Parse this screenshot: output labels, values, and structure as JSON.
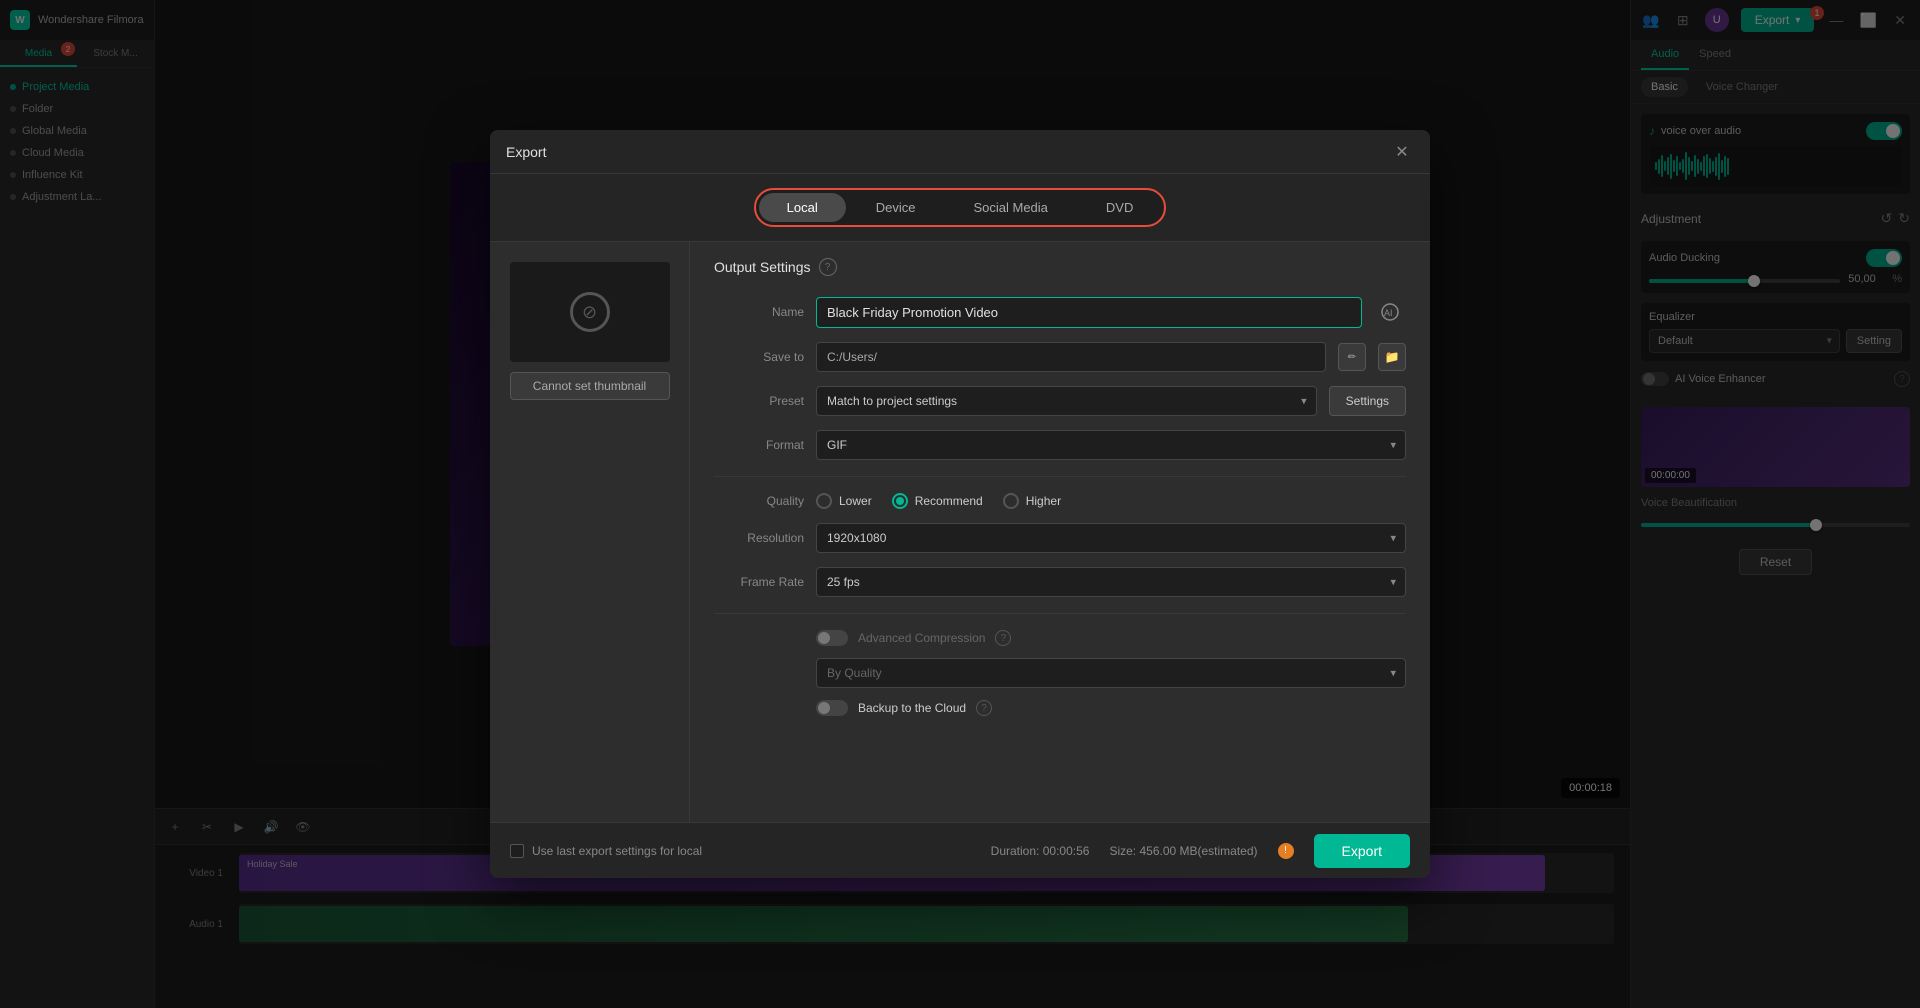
{
  "app": {
    "title": "Wondershare Filmora",
    "logo": "W"
  },
  "header": {
    "export_label": "Export",
    "badge_1": "1"
  },
  "sidebar": {
    "tabs": [
      {
        "id": "media",
        "label": "Media",
        "active": true
      },
      {
        "id": "stock",
        "label": "Stock M...",
        "active": false
      }
    ],
    "badge": "2",
    "sections": [
      {
        "id": "project-media",
        "label": "Project Media",
        "active": true
      },
      {
        "id": "folder",
        "label": "Folder",
        "active": false
      },
      {
        "id": "global-media",
        "label": "Global Media",
        "active": false
      },
      {
        "id": "cloud-media",
        "label": "Cloud Media",
        "active": false
      },
      {
        "id": "influence-kit",
        "label": "Influence Kit",
        "active": false
      },
      {
        "id": "adjustment-l",
        "label": "Adjustment La...",
        "active": false
      }
    ]
  },
  "right_panel": {
    "tabs": [
      "Audio",
      "Speed"
    ],
    "active_tab": "Audio",
    "subtabs": [
      "Basic",
      "Voice Changer"
    ],
    "active_subtab": "Basic",
    "sections": {
      "adjustment": "Adjustment",
      "audio_ducking": "Audio Ducking",
      "audio_ducking_value": "50,00",
      "audio_ducking_unit": "%",
      "equalizer": "Equalizer",
      "equalizer_preset": "Default",
      "equalizer_setting": "Setting",
      "ai_voice_enhancer": "AI Voice Enhancer",
      "voice_beautification": "Voice Beautification",
      "reset": "Reset"
    }
  },
  "modal": {
    "title": "Export",
    "tabs": [
      "Local",
      "Device",
      "Social Media",
      "DVD"
    ],
    "active_tab": "Local",
    "output_settings_label": "Output Settings",
    "fields": {
      "name_label": "Name",
      "name_value": "Black Friday Promotion Video",
      "save_to_label": "Save to",
      "save_to_value": "C:/Users/",
      "preset_label": "Preset",
      "preset_value": "Match to project settings",
      "format_label": "Format",
      "format_value": "GIF"
    },
    "quality": {
      "label": "Quality",
      "options": [
        "Lower",
        "Recommend",
        "Higher"
      ],
      "selected": "Recommend"
    },
    "resolution": {
      "label": "Resolution",
      "value": "1920x1080"
    },
    "frame_rate": {
      "label": "Frame Rate",
      "value": "25 fps"
    },
    "advanced_compression": {
      "label": "Advanced Compression",
      "enabled": false
    },
    "by_quality": {
      "value": "By Quality"
    },
    "backup": {
      "label": "Backup to the Cloud",
      "enabled": false
    },
    "thumbnail": {
      "cannot_set": "Cannot set thumbnail"
    },
    "footer": {
      "use_last_settings": "Use last export settings for local",
      "duration_label": "Duration:",
      "duration_value": "00:00:56",
      "size_label": "Size:",
      "size_value": "456.00 MB(estimated)",
      "export_btn": "Export"
    }
  }
}
